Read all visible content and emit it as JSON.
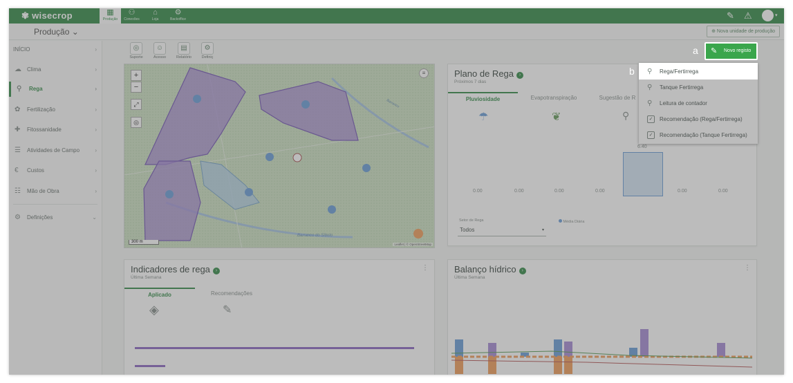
{
  "app": {
    "logo": "wisecrop"
  },
  "topnav": [
    {
      "label": "Produção",
      "icon": "farm-icon",
      "glyph": "▦",
      "active": true
    },
    {
      "label": "Conexões",
      "icon": "network-icon",
      "glyph": "⚇",
      "active": false
    },
    {
      "label": "Loja",
      "icon": "shop-icon",
      "glyph": "⌂",
      "active": false
    },
    {
      "label": "Backoffice",
      "icon": "backoffice-icon",
      "glyph": "⚙",
      "active": false
    }
  ],
  "subbar": {
    "production_dropdown": "Produção ⌄",
    "new_unit": "Nova unidade de produção"
  },
  "sidebar": [
    {
      "label": "INÍCIO",
      "icon": "",
      "active": false
    },
    {
      "label": "Clima",
      "icon": "☁",
      "active": false
    },
    {
      "label": "Rega",
      "icon": "⚲",
      "active": true
    },
    {
      "label": "Fertilização",
      "icon": "✿",
      "active": false
    },
    {
      "label": "Fitossanidade",
      "icon": "✚",
      "active": false
    },
    {
      "label": "Atividades de Campo",
      "icon": "☰",
      "active": false
    },
    {
      "label": "Custos",
      "icon": "€",
      "active": false
    },
    {
      "label": "Mão de Obra",
      "icon": "☷",
      "active": false
    },
    {
      "label": "Definições",
      "icon": "⚙",
      "active": false
    }
  ],
  "toolbar": [
    {
      "label": "Suporte",
      "icon": "support-icon",
      "glyph": "◎"
    },
    {
      "label": "Acesso",
      "icon": "user-access-icon",
      "glyph": "☺"
    },
    {
      "label": "Relatório",
      "icon": "report-icon",
      "glyph": "▤"
    },
    {
      "label": "Definiç",
      "icon": "settings-icon",
      "glyph": "⚙"
    }
  ],
  "map": {
    "scale": "300 m",
    "river_label": "Barranco do Sibolo",
    "river_label_2": "Barranco",
    "attribution": "Leaflet | © OpenStreetMap"
  },
  "plano_rega": {
    "title": "Plano de Rega",
    "subtitle": "Próximos 7 dias",
    "tabs": [
      "Pluviosidade",
      "Evapotranspiração",
      "Sugestão de R"
    ],
    "values": [
      "0.00",
      "0.00",
      "0.00",
      "0.00",
      "6.40",
      "0.00",
      "0.00"
    ],
    "highlighted_value": 6.4,
    "sector_label": "Setor de Rega",
    "sector_value": "Todos",
    "legend": "Média Diária"
  },
  "indicadores": {
    "title": "Indicadores de rega",
    "subtitle": "Última Semana",
    "tabs": [
      "Aplicado",
      "Recomendações"
    ]
  },
  "balanco": {
    "title": "Balanço hídrico",
    "subtitle": "Última Semana"
  },
  "new_record_button": "Novo registo",
  "markers": {
    "a": "a",
    "b": "b"
  },
  "menu": [
    {
      "label": "Rega/Fertirrega",
      "icon": "sprinkler-icon"
    },
    {
      "label": "Tanque Fertirrega",
      "icon": "tank-icon"
    },
    {
      "label": "Leitura de contador",
      "icon": "meter-icon"
    },
    {
      "label": "Recomendação (Rega/Fertirrega)",
      "icon": "recommendation-icon"
    },
    {
      "label": "Recomendação (Tanque Fertirrega)",
      "icon": "recommendation-tank-icon"
    }
  ],
  "colors": {
    "brand": "#3a8f4e",
    "button": "#3aa64c",
    "purple": "#8e6bc4",
    "blue_bar": "#6ea1d8",
    "orange_bar": "#f0a060"
  }
}
